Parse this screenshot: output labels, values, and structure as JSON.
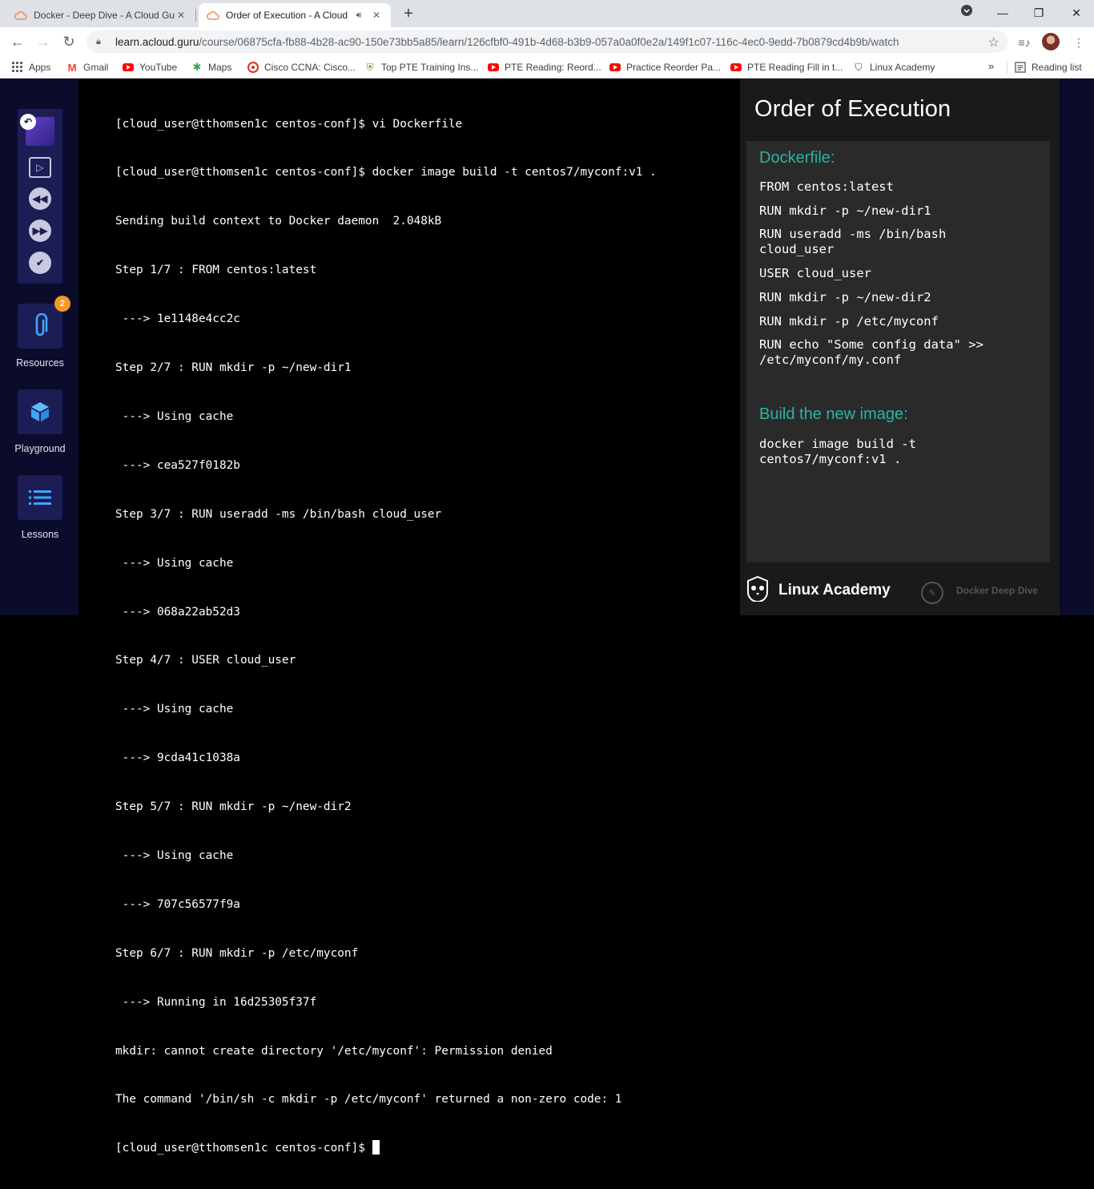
{
  "browser": {
    "tabs": [
      {
        "title": "Docker - Deep Dive - A Cloud Gu",
        "active": false
      },
      {
        "title": "Order of Execution - A Cloud",
        "active": true
      }
    ],
    "url": {
      "host": "learn.acloud.guru",
      "path": "/course/06875cfa-fb88-4b28-ac90-150e73bb5a85/learn/126cfbf0-491b-4d68-b3b9-057a0a0f0e2a/149f1c07-116c-4ec0-9edd-7b0879cd4b9b/watch"
    },
    "bookmarks": [
      "Apps",
      "Gmail",
      "YouTube",
      "Maps",
      "Cisco CCNA: Cisco...",
      "Top PTE Training Ins...",
      "PTE Reading: Reord...",
      "Practice Reorder Pa...",
      "PTE Reading Fill in t...",
      "Linux Academy"
    ],
    "reading_list": "Reading list"
  },
  "sidebar": {
    "resources_label": "Resources",
    "resources_badge": "2",
    "playground_label": "Playground",
    "lessons_label": "Lessons"
  },
  "terminal": {
    "lines": [
      "[cloud_user@tthomsen1c centos-conf]$ vi Dockerfile",
      "[cloud_user@tthomsen1c centos-conf]$ docker image build -t centos7/myconf:v1 .",
      "Sending build context to Docker daemon  2.048kB",
      "Step 1/7 : FROM centos:latest",
      " ---> 1e1148e4cc2c",
      "Step 2/7 : RUN mkdir -p ~/new-dir1",
      " ---> Using cache",
      " ---> cea527f0182b",
      "Step 3/7 : RUN useradd -ms /bin/bash cloud_user",
      " ---> Using cache",
      " ---> 068a22ab52d3",
      "Step 4/7 : USER cloud_user",
      " ---> Using cache",
      " ---> 9cda41c1038a",
      "Step 5/7 : RUN mkdir -p ~/new-dir2",
      " ---> Using cache",
      " ---> 707c56577f9a",
      "Step 6/7 : RUN mkdir -p /etc/myconf",
      " ---> Running in 16d25305f37f",
      "mkdir: cannot create directory '/etc/myconf': Permission denied",
      "The command '/bin/sh -c mkdir -p /etc/myconf' returned a non-zero code: 1"
    ],
    "prompt": "[cloud_user@tthomsen1c centos-conf]$ "
  },
  "slide": {
    "title": "Order of Execution",
    "dockerfile_heading": "Dockerfile:",
    "dockerfile_lines": [
      "FROM centos:latest",
      "RUN mkdir -p ~/new-dir1",
      "RUN useradd -ms /bin/bash\ncloud_user",
      "USER cloud_user",
      "RUN mkdir -p ~/new-dir2",
      "RUN mkdir -p /etc/myconf",
      "RUN echo \"Some config data\" >>\n/etc/myconf/my.conf"
    ],
    "build_heading": "Build the new image:",
    "build_command": "docker image build -t\ncentos7/myconf:v1 .",
    "brand": "Linux Academy",
    "course_watermark": "Docker Deep Dive"
  }
}
